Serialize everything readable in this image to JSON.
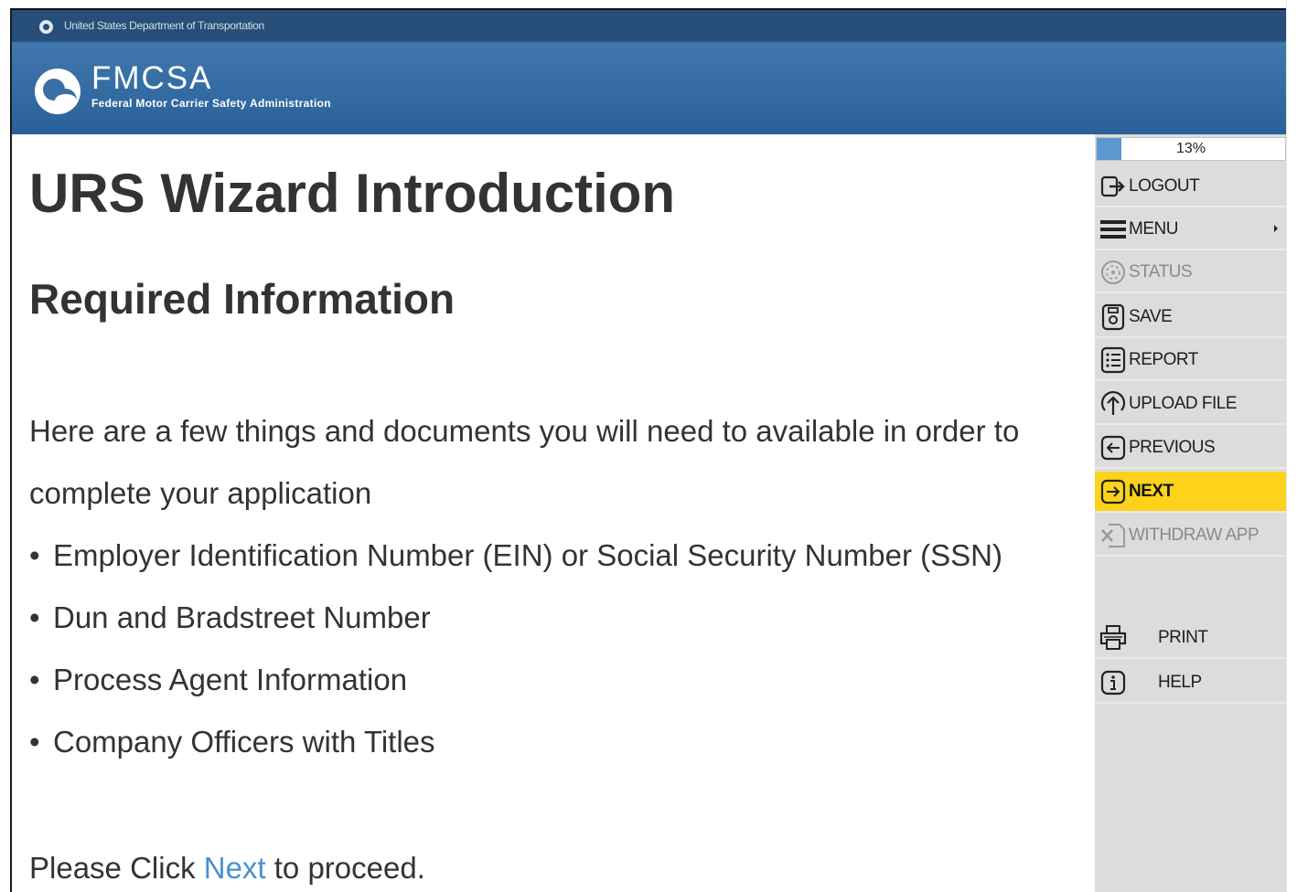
{
  "header": {
    "dot_title": "United States Department of Transportation",
    "agency_acronym": "FMCSA",
    "agency_name": "Federal Motor Carrier Safety Administration"
  },
  "main": {
    "page_title": "URS Wizard Introduction",
    "section_title": "Required Information",
    "intro_line_1": "Here are a few things and documents you will need to available in order to",
    "intro_line_2": "complete your application",
    "bullet_char": "•",
    "requirements": [
      "Employer Identification Number (EIN) or Social Security Number (SSN)",
      "Dun and Bradstreet Number",
      "Process Agent Information",
      "Company Officers with Titles"
    ],
    "proceed_prefix": "Please Click ",
    "proceed_link": "Next",
    "proceed_suffix": " to proceed."
  },
  "sidebar": {
    "progress_value": 0.13,
    "progress_label": "13%",
    "items": [
      {
        "label": "LOGOUT",
        "icon": "logout-icon"
      },
      {
        "label": "MENU",
        "icon": "menu-icon"
      },
      {
        "label": "STATUS",
        "icon": "status-icon",
        "disabled": true
      },
      {
        "label": "SAVE",
        "icon": "save-icon"
      },
      {
        "label": "REPORT",
        "icon": "report-icon"
      },
      {
        "label": "UPLOAD FILE",
        "icon": "upload-icon"
      },
      {
        "label": "PREVIOUS",
        "icon": "previous-icon"
      },
      {
        "label": "NEXT",
        "icon": "next-icon",
        "active": true
      },
      {
        "label": "WITHDRAW APP",
        "icon": "withdraw-icon",
        "disabled": true
      },
      {
        "label": "PRINT",
        "icon": "print-icon"
      },
      {
        "label": "HELP",
        "icon": "help-icon"
      }
    ]
  },
  "colors": {
    "header_dark": "#274e79",
    "header_blue": "#3f78ad",
    "next_highlight": "#fcd21a",
    "link": "#4a8fd0",
    "progress_fill": "#5b98cf",
    "sidebar_bg": "#dcdcdc"
  }
}
